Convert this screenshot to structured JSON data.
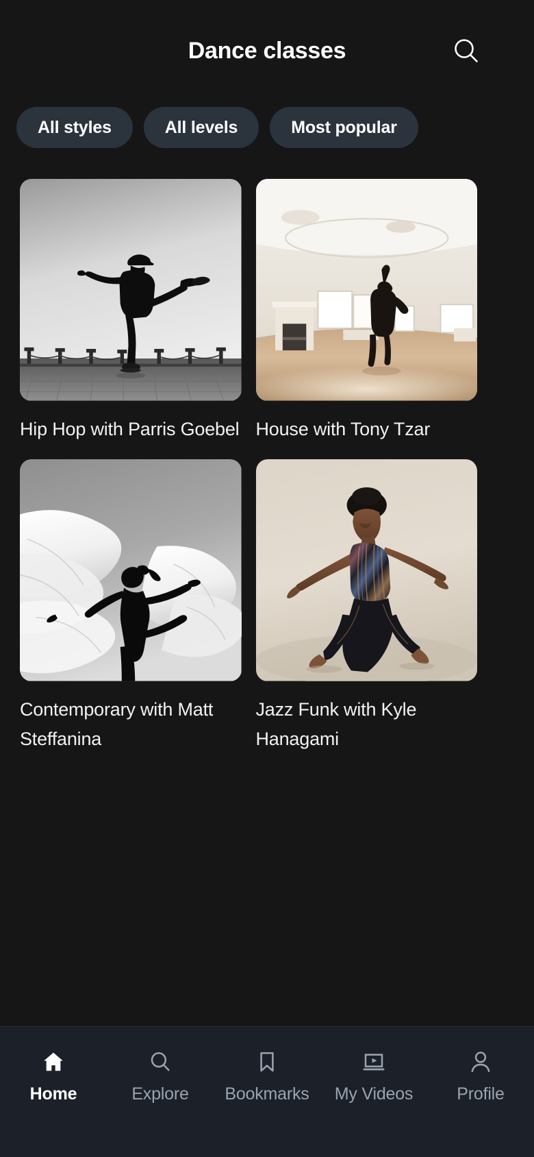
{
  "header": {
    "title": "Dance classes",
    "search_icon": "search-icon"
  },
  "filters": [
    {
      "label": "All styles",
      "name": "filter-chip-all-styles"
    },
    {
      "label": "All levels",
      "name": "filter-chip-all-levels"
    },
    {
      "label": "Most popular",
      "name": "filter-chip-most-popular"
    }
  ],
  "classes": [
    {
      "title": "Hip Hop with Parris Goebel",
      "image_alt": "black-and-white photo of hip hop dancer balancing with leg extended on a tiled waterfront plaza"
    },
    {
      "title": "House with Tony Tzar",
      "image_alt": "silhouetted dancer leaping with arm raised in a bright empty studio with wooden floor and fireplace"
    },
    {
      "title": "Contemporary with Matt Steffanina",
      "image_alt": "black-and-white photo of contemporary dancer in black leotard with flowing white fabric"
    },
    {
      "title": "Jazz Funk with Kyle Hanagami",
      "image_alt": "dancer in striped jumpsuit with arms outstretched on beige studio backdrop"
    }
  ],
  "bottom_nav": [
    {
      "label": "Home",
      "icon": "home-icon",
      "active": true
    },
    {
      "label": "Explore",
      "icon": "search-icon",
      "active": false
    },
    {
      "label": "Bookmarks",
      "icon": "bookmark-icon",
      "active": false
    },
    {
      "label": "My Videos",
      "icon": "video-icon",
      "active": false
    },
    {
      "label": "Profile",
      "icon": "person-icon",
      "active": false
    }
  ],
  "colors": {
    "background": "#161616",
    "chip_background": "#2b333d",
    "nav_background": "#1b2029",
    "text_primary": "#ffffff",
    "text_muted": "#9aa3ae"
  }
}
